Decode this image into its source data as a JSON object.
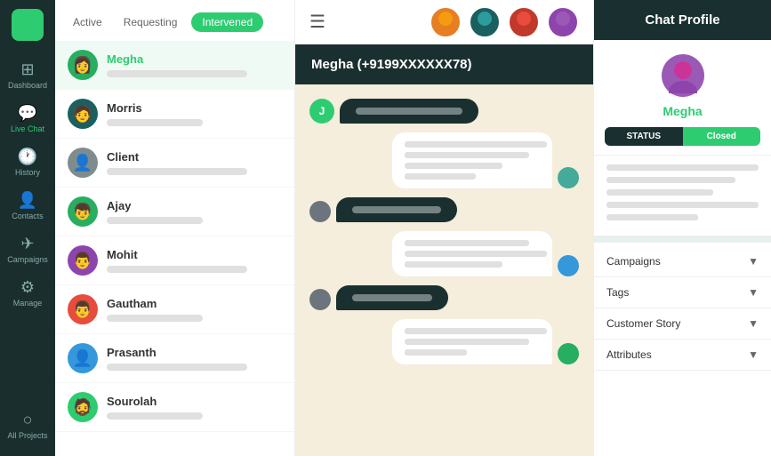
{
  "sidebar": {
    "logo": "⚡",
    "items": [
      {
        "id": "dashboard",
        "label": "Dashboard",
        "icon": "⊞"
      },
      {
        "id": "live-chat",
        "label": "Live Chat",
        "icon": "💬",
        "active": true
      },
      {
        "id": "history",
        "label": "History",
        "icon": "🕐"
      },
      {
        "id": "contacts",
        "label": "Contacts",
        "icon": "👤"
      },
      {
        "id": "campaigns",
        "label": "Campaigns",
        "icon": "✈"
      },
      {
        "id": "manage",
        "label": "Manage",
        "icon": "⚙"
      },
      {
        "id": "all-projects",
        "label": "All Projects",
        "icon": "○"
      }
    ]
  },
  "tabs": [
    {
      "id": "active",
      "label": "Active"
    },
    {
      "id": "requesting",
      "label": "Requesting"
    },
    {
      "id": "intervened",
      "label": "Intervened",
      "active": true
    }
  ],
  "contacts": [
    {
      "id": 1,
      "name": "Megha",
      "selected": true,
      "color": "#27ae60"
    },
    {
      "id": 2,
      "name": "Morris",
      "selected": false,
      "color": "#1a6060"
    },
    {
      "id": 3,
      "name": "Client",
      "selected": false,
      "color": "#7f8c8d"
    },
    {
      "id": 4,
      "name": "Ajay",
      "selected": false,
      "color": "#27ae60"
    },
    {
      "id": 5,
      "name": "Mohit",
      "selected": false,
      "color": "#8e44ad"
    },
    {
      "id": 6,
      "name": "Gautham",
      "selected": false,
      "color": "#e74c3c"
    },
    {
      "id": 7,
      "name": "Prasanth",
      "selected": false,
      "color": "#3498db"
    },
    {
      "id": 8,
      "name": "Sourolah",
      "selected": false,
      "color": "#2ecc71"
    }
  ],
  "chat": {
    "header": "Megha (+9199XXXXXX78)",
    "messages": []
  },
  "profile": {
    "header": "Chat Profile",
    "name": "Megha",
    "status_label": "STATUS",
    "status_value": "Closed"
  },
  "accordion": [
    {
      "id": "campaigns",
      "label": "Campaigns"
    },
    {
      "id": "tags",
      "label": "Tags"
    },
    {
      "id": "customer-story",
      "label": "Customer Story"
    },
    {
      "id": "attributes",
      "label": "Attributes"
    }
  ],
  "top_avatars": [
    {
      "id": 1,
      "color": "#e67e22",
      "emoji": "😊"
    },
    {
      "id": 2,
      "color": "#1a6060",
      "emoji": "🧑"
    },
    {
      "id": 3,
      "color": "#c0392b",
      "emoji": "😎"
    },
    {
      "id": 4,
      "color": "#8e44ad",
      "emoji": "👩"
    }
  ]
}
